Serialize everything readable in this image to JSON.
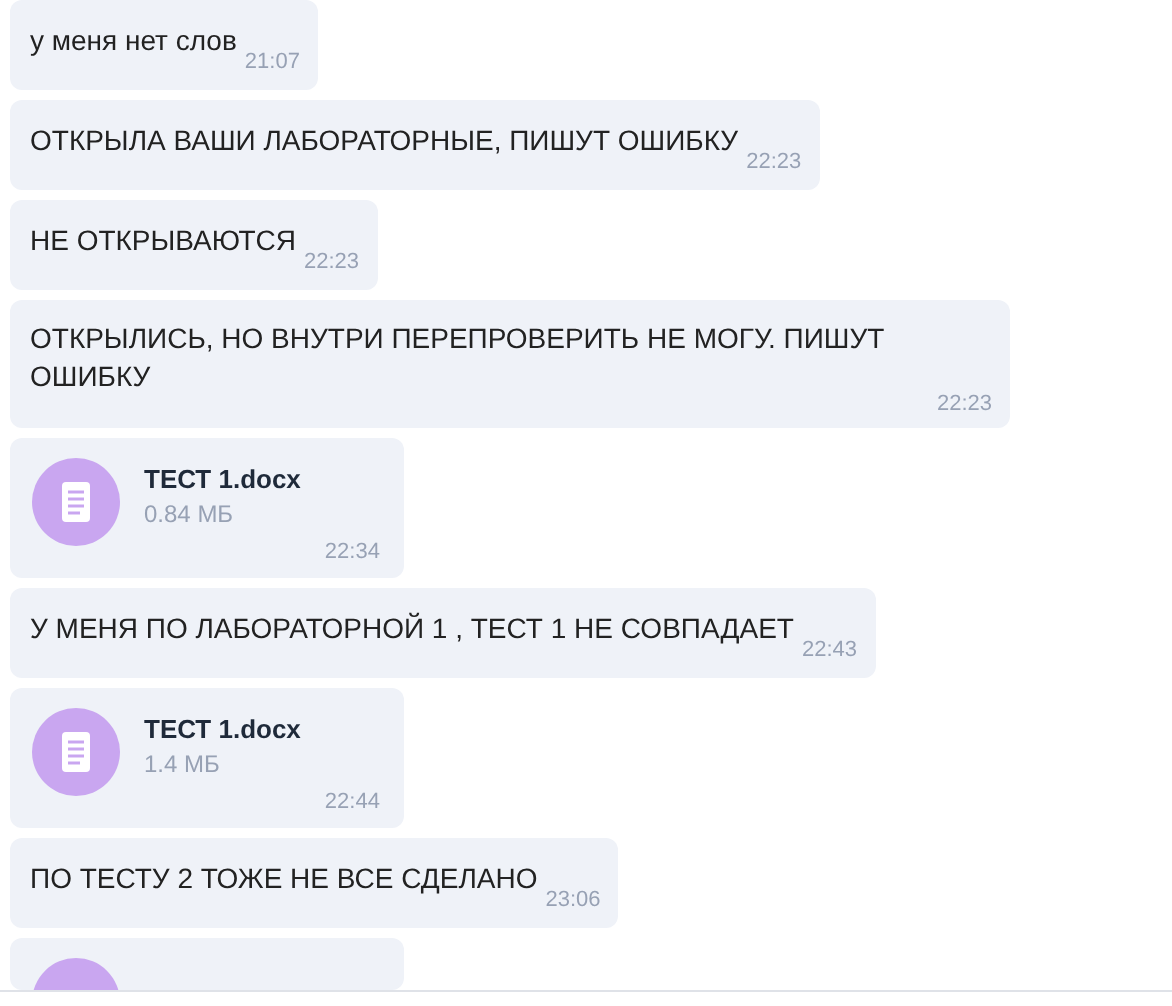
{
  "messages": [
    {
      "kind": "text",
      "text": "у меня нет слов",
      "time": "21:07"
    },
    {
      "kind": "text",
      "text": "ОТКРЫЛА ВАШИ ЛАБОРАТОРНЫЕ, ПИШУТ ОШИБКУ",
      "time": "22:23"
    },
    {
      "kind": "text",
      "text": "НЕ ОТКРЫВАЮТСЯ",
      "time": "22:23"
    },
    {
      "kind": "text",
      "text": "ОТКРЫЛИСЬ, НО ВНУТРИ ПЕРЕПРОВЕРИТЬ НЕ МОГУ. ПИШУТ ОШИБКУ",
      "time": "22:23"
    },
    {
      "kind": "file",
      "name": "ТЕСТ 1.docx",
      "size": "0.84 МБ",
      "time": "22:34"
    },
    {
      "kind": "text",
      "text": "У МЕНЯ ПО ЛАБОРАТОРНОЙ 1 , ТЕСТ 1 НЕ СОВПАДАЕТ",
      "time": "22:43"
    },
    {
      "kind": "file",
      "name": "ТЕСТ 1.docx",
      "size": "1.4 МБ",
      "time": "22:44"
    },
    {
      "kind": "text",
      "text": "ПО ТЕСТУ 2 ТОЖЕ НЕ ВСЕ СДЕЛАНО",
      "time": "23:06"
    },
    {
      "kind": "cut"
    }
  ]
}
